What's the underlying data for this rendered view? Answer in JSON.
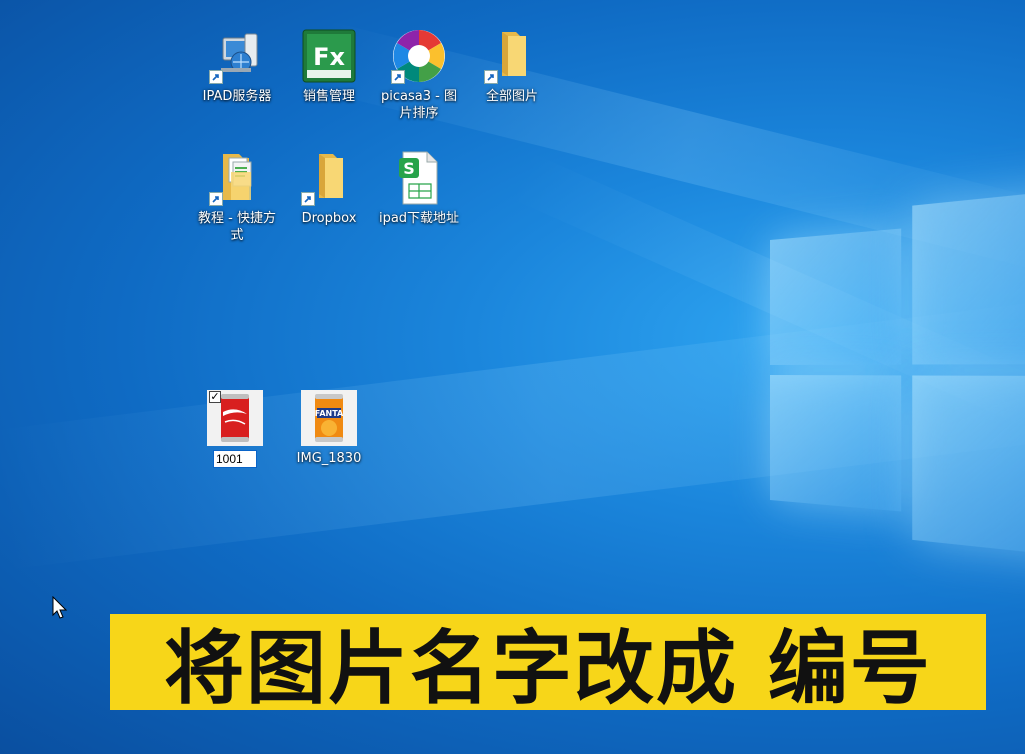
{
  "desktop": {
    "icons": [
      {
        "label": "IPAD服务器",
        "icon": "server-icon"
      },
      {
        "label": "销售管理",
        "icon": "excel-fx-icon"
      },
      {
        "label": "picasa3 - 图片排序",
        "icon": "picasa-icon"
      },
      {
        "label": "全部图片",
        "icon": "folder-icon"
      },
      {
        "label": "教程 - 快捷方式",
        "icon": "folder-files-icon"
      },
      {
        "label": "Dropbox",
        "icon": "folder-icon"
      },
      {
        "label": "ipad下载地址",
        "icon": "spreadsheet-icon"
      }
    ],
    "images": [
      {
        "rename_value": "1001",
        "icon": "coca-cola-can-thumbnail",
        "selected": true
      },
      {
        "label": "IMG_1830",
        "icon": "fanta-can-thumbnail"
      }
    ]
  },
  "caption": {
    "text": "将图片名字改成 编号"
  },
  "colors": {
    "caption_bg": "#f7d619",
    "desktop_blue": "#1b86dc",
    "selection_border": "#0a64c8"
  }
}
